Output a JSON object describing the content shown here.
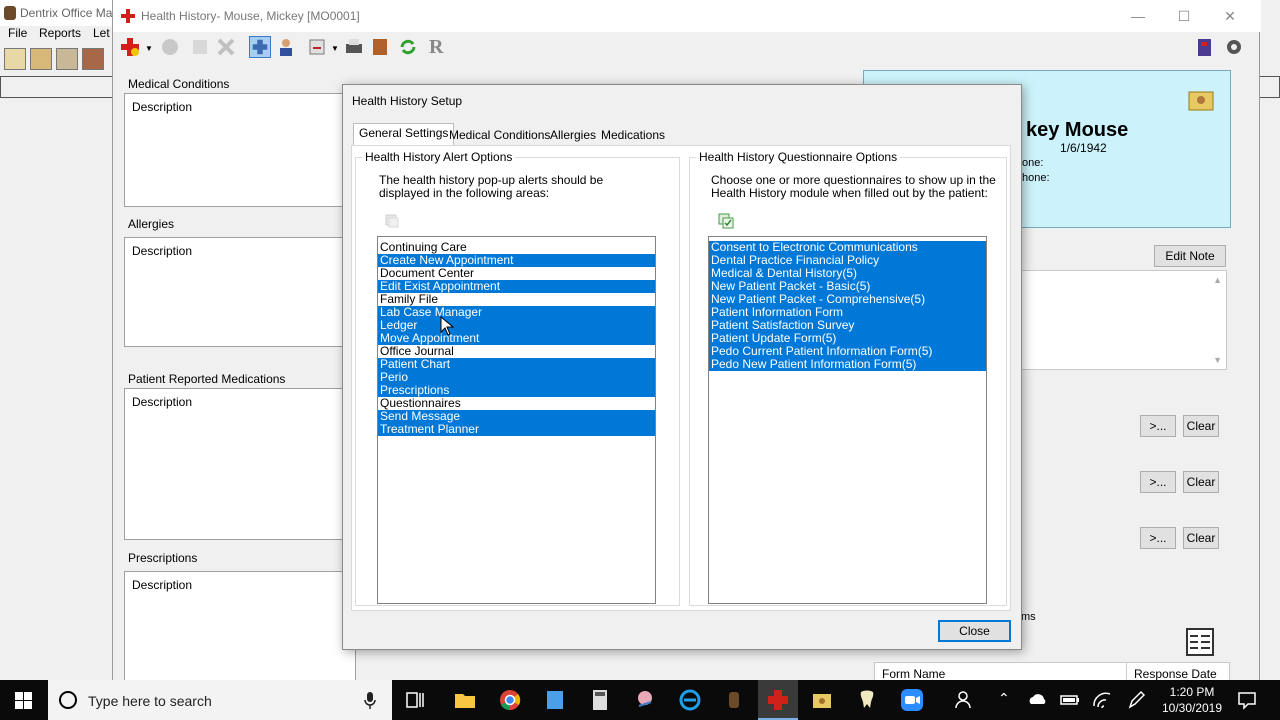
{
  "background_app": {
    "title": "Dentrix Office Ma",
    "menu": [
      "File",
      "Reports",
      "Let"
    ]
  },
  "hh_window": {
    "title": "Health History- Mouse, Mickey [MO0001]",
    "sections": {
      "medical_conditions": "Medical Conditions",
      "allergies": "Allergies",
      "patient_reported_medications": "Patient Reported Medications",
      "prescriptions": "Prescriptions"
    },
    "description_header": "Description",
    "patient": {
      "name": "key Mouse",
      "dob": "1/6/1942",
      "phone_label_1": "one:",
      "phone_label_2": "hone:"
    },
    "edit_note_label": "Edit Note",
    "more_label": ">...",
    "clear_label": "Clear",
    "forms_partial": "ms",
    "form_name_col": "Form Name",
    "response_date_col": "Response Date"
  },
  "dialog": {
    "title": "Health History Setup",
    "tabs": [
      "General Settings",
      "Medical Conditions",
      "Allergies",
      "Medications"
    ],
    "active_tab": "General Settings",
    "alert_group": {
      "title": "Health History Alert Options",
      "desc_line1": "The health history pop-up alerts should be",
      "desc_line2": "displayed in the following areas:",
      "items": [
        {
          "label": "Continuing Care",
          "selected": false
        },
        {
          "label": "Create New Appointment",
          "selected": true
        },
        {
          "label": "Document Center",
          "selected": false
        },
        {
          "label": "Edit Exist Appointment",
          "selected": true
        },
        {
          "label": "Family File",
          "selected": false
        },
        {
          "label": "Lab Case Manager",
          "selected": true
        },
        {
          "label": "Ledger",
          "selected": true
        },
        {
          "label": "Move Appointment",
          "selected": true
        },
        {
          "label": "Office Journal",
          "selected": false
        },
        {
          "label": "Patient Chart",
          "selected": true
        },
        {
          "label": "Perio",
          "selected": true
        },
        {
          "label": "Prescriptions",
          "selected": true
        },
        {
          "label": "Questionnaires",
          "selected": false
        },
        {
          "label": "Send Message",
          "selected": true
        },
        {
          "label": "Treatment Planner",
          "selected": true
        }
      ]
    },
    "questionnaire_group": {
      "title": "Health History Questionnaire Options",
      "desc_line1": "Choose one or more questionnaires to show up in the",
      "desc_line2": "Health History module when filled out by the patient:",
      "items": [
        {
          "label": "Consent to Electronic Communications",
          "selected": true
        },
        {
          "label": "Dental Practice Financial Policy",
          "selected": true
        },
        {
          "label": "Medical & Dental History(5)",
          "selected": true
        },
        {
          "label": "New Patient Packet - Basic(5)",
          "selected": true
        },
        {
          "label": "New Patient Packet - Comprehensive(5)",
          "selected": true
        },
        {
          "label": "Patient Information Form",
          "selected": true
        },
        {
          "label": "Patient Satisfaction Survey",
          "selected": true
        },
        {
          "label": "Patient Update Form(5)",
          "selected": true
        },
        {
          "label": "Pedo Current Patient Information Form(5)",
          "selected": true
        },
        {
          "label": "Pedo New Patient Information Form(5)",
          "selected": true
        }
      ]
    },
    "close_label": "Close"
  },
  "taskbar": {
    "search_placeholder": "Type here to search",
    "time": "1:20 PM",
    "date": "10/30/2019"
  },
  "colors": {
    "selection": "#0078d7",
    "patient_card": "#ccf3fb",
    "taskbar": "#0a0a0a"
  }
}
